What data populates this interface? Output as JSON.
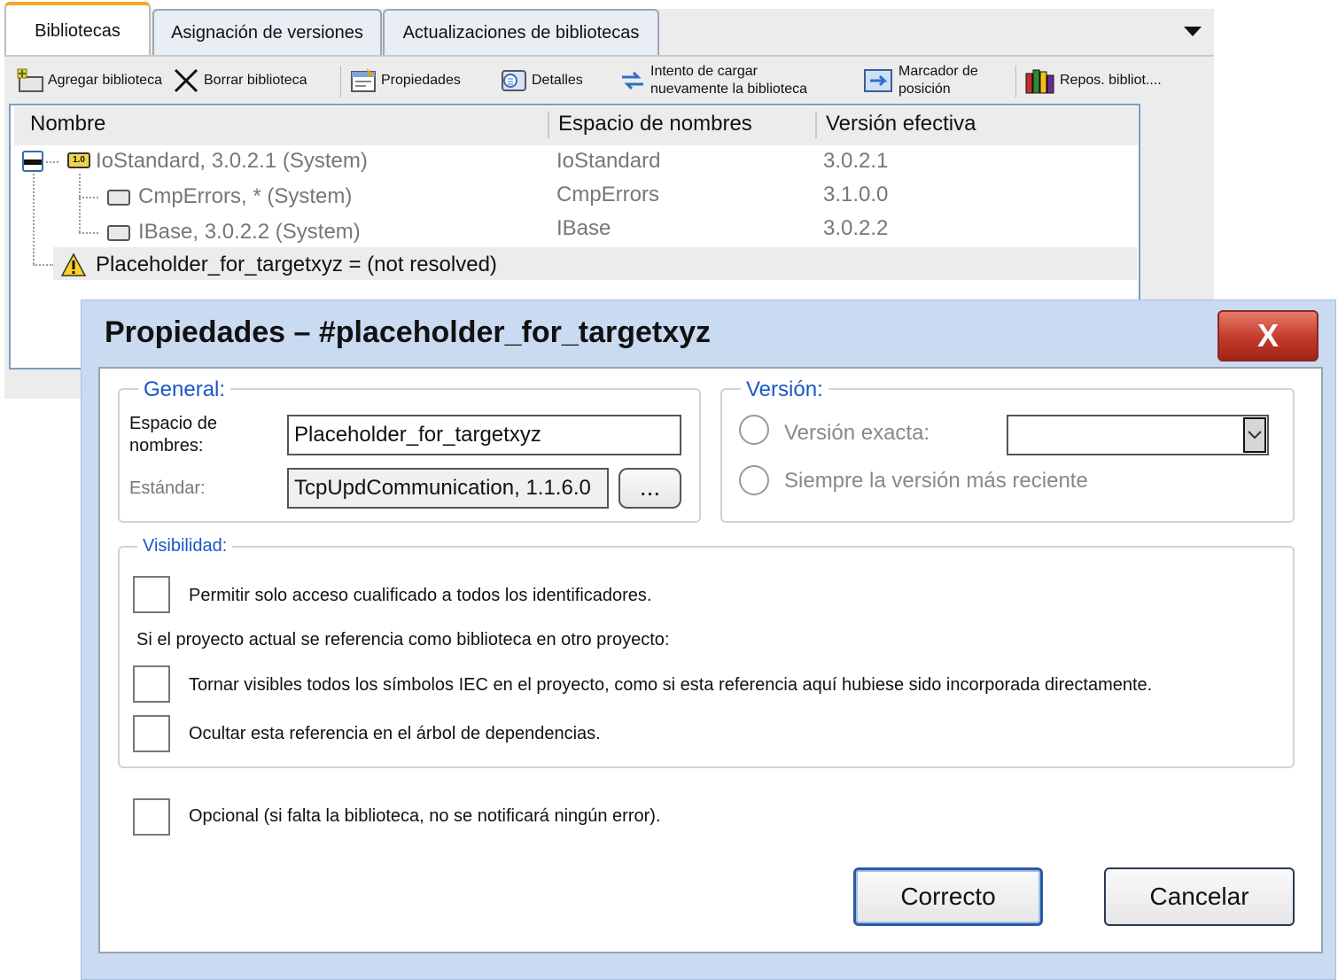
{
  "tabs": [
    {
      "label": "Bibliotecas",
      "active": true
    },
    {
      "label": "Asignación de versiones",
      "active": false
    },
    {
      "label": "Actualizaciones de bibliotecas",
      "active": false
    }
  ],
  "toolbar": {
    "add_library": "Agregar biblioteca",
    "delete_library": "Borrar biblioteca",
    "properties": "Propiedades",
    "details": "Detalles",
    "reload_line1": "Intento de cargar",
    "reload_line2": "nuevamente la biblioteca",
    "placeholder_line1": "Marcador de",
    "placeholder_line2": "posición",
    "repository": "Repos. bibliot...."
  },
  "tree": {
    "columns": [
      "Nombre",
      "Espacio de nombres",
      "Versión efectiva"
    ],
    "rows": [
      {
        "name": "IoStandard, 3.0.2.1 (System)",
        "namespace": "IoStandard",
        "version": "3.0.2.1"
      },
      {
        "name": "CmpErrors, * (System)",
        "namespace": "CmpErrors",
        "version": "3.1.0.0"
      },
      {
        "name": "IBase, 3.0.2.2 (System)",
        "namespace": "IBase",
        "version": "3.0.2.2"
      },
      {
        "name": "Placeholder_for_targetxyz = (not resolved)",
        "namespace": "",
        "version": ""
      }
    ]
  },
  "dialog": {
    "title": "Propiedades – #placeholder_for_targetxyz",
    "close_label": "X",
    "general": {
      "legend": "General:",
      "namespace_label_1": "Espacio de",
      "namespace_label_2": "nombres:",
      "namespace_value": "Placeholder_for_targetxyz",
      "standard_label": "Estándar:",
      "standard_value": "TcpUpdCommunication, 1.1.6.0",
      "browse_label": "..."
    },
    "version": {
      "legend": "Versión:",
      "exact": "Versión exacta:",
      "latest": "Siempre la versión más reciente"
    },
    "visibility": {
      "legend": "Visibilidad:",
      "qualified_access": "Permitir solo acceso cualificado a todos los identificadores.",
      "reference_note": "Si el proyecto actual se referencia como biblioteca en otro proyecto:",
      "make_visible": "Tornar visibles todos los símbolos IEC en el proyecto, como si esta referencia aquí hubiese sido incorporada directamente.",
      "hide_reference": "Ocultar esta referencia en el árbol de dependencias."
    },
    "optional": "Opcional (si falta la biblioteca, no se notificará ningún error).",
    "ok": "Correcto",
    "cancel": "Cancelar"
  }
}
